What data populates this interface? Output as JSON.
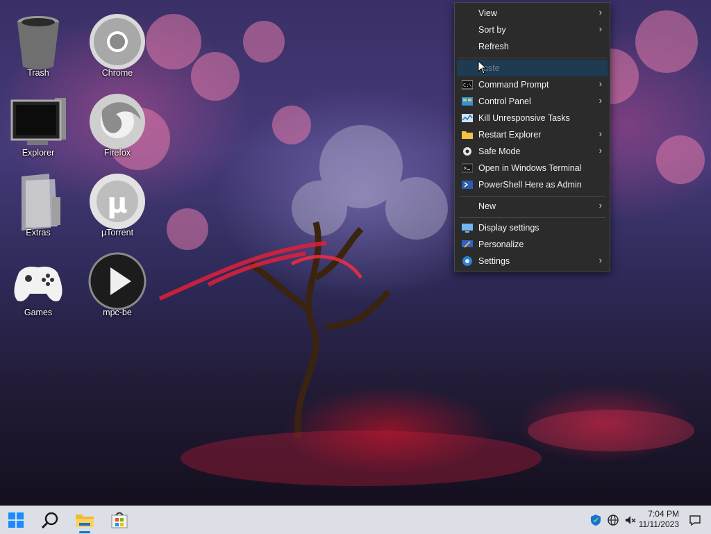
{
  "desktop": {
    "icons": [
      {
        "label": "Trash",
        "icon": "trash-bin-icon"
      },
      {
        "label": "Chrome",
        "icon": "chrome-icon"
      },
      {
        "label": "Explorer",
        "icon": "computer-monitor-icon"
      },
      {
        "label": "Firefox",
        "icon": "firefox-icon"
      },
      {
        "label": "Extras",
        "icon": "folder-extras-icon"
      },
      {
        "label": "µTorrent",
        "icon": "utorrent-icon"
      },
      {
        "label": "Games",
        "icon": "gamepad-icon"
      },
      {
        "label": "mpc-be",
        "icon": "play-icon"
      }
    ]
  },
  "context_menu": {
    "items": [
      {
        "label": "View",
        "submenu": true
      },
      {
        "label": "Sort by",
        "submenu": true
      },
      {
        "label": "Refresh",
        "submenu": false
      },
      {
        "label": "aste",
        "submenu": false,
        "disabled": true,
        "hovered": true
      },
      {
        "label": "Command Prompt",
        "submenu": true,
        "icon": "cmd-icon"
      },
      {
        "label": "Control Panel",
        "submenu": true,
        "icon": "control-panel-icon"
      },
      {
        "label": "Kill Unresponsive Tasks",
        "submenu": false,
        "icon": "task-monitor-icon"
      },
      {
        "label": "Restart Explorer",
        "submenu": true,
        "icon": "folder-icon"
      },
      {
        "label": "Safe Mode",
        "submenu": true,
        "icon": "gear-icon"
      },
      {
        "label": "Open in Windows Terminal",
        "submenu": false,
        "icon": "terminal-icon"
      },
      {
        "label": "PowerShell Here as Admin",
        "submenu": false,
        "icon": "powershell-icon"
      },
      {
        "label": "New",
        "submenu": true
      },
      {
        "label": "Display settings",
        "submenu": false,
        "icon": "display-icon"
      },
      {
        "label": "Personalize",
        "submenu": false,
        "icon": "personalize-icon"
      },
      {
        "label": "Settings",
        "submenu": true,
        "icon": "settings-gear-icon"
      }
    ],
    "submenu_arrow": "›"
  },
  "taskbar": {
    "buttons": [
      "start-icon",
      "search-icon",
      "file-explorer-icon",
      "store-icon"
    ],
    "tray": [
      "security-shield-icon",
      "network-globe-icon",
      "volume-muted-icon"
    ],
    "time": "7:04 PM",
    "date": "11/11/2023",
    "notification_icon": "notification-icon"
  },
  "colors": {
    "menu_bg": "#2b2b2b",
    "menu_hover": "#1f3b52",
    "taskbar_bg": "#dcdfe6",
    "accent": "#0078d4"
  }
}
